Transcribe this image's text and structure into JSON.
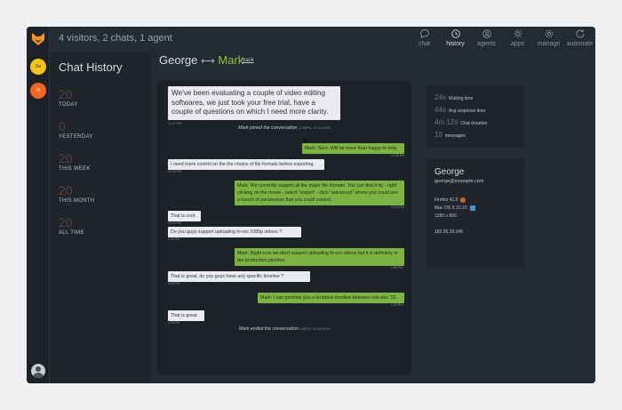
{
  "header": {
    "visitors_text": "4 visitors, 2 chats, 1 agent"
  },
  "nav": [
    {
      "label": "chat",
      "icon": "chat-icon"
    },
    {
      "label": "history",
      "icon": "history-icon",
      "active": true
    },
    {
      "label": "agents",
      "icon": "agents-icon"
    },
    {
      "label": "apps",
      "icon": "apps-icon"
    },
    {
      "label": "manage",
      "icon": "gear-icon"
    },
    {
      "label": "automate",
      "icon": "automate-icon"
    }
  ],
  "rail": {
    "avatars": [
      {
        "initials": "Ge",
        "color": "#f5c518"
      },
      {
        "initials": "N",
        "color": "#f26522"
      }
    ]
  },
  "sidebar": {
    "title": "Chat History",
    "stats": [
      {
        "value": "20",
        "label": "TODAY"
      },
      {
        "value": "0",
        "label": "YESTERDAY"
      },
      {
        "value": "20",
        "label": "THIS WEEK"
      },
      {
        "value": "20",
        "label": "THIS MONTH"
      },
      {
        "value": "20",
        "label": "ALL TIME"
      }
    ]
  },
  "conversation": {
    "visitor": "George",
    "arrow": "⟷",
    "agent": "Mark",
    "back_label": "back",
    "highlight_text": "We've been evaluating a couple of video editing softwares, we just took your free trial, have a couple of questions on which I need more clarity.",
    "highlight_time": "12:07 PM",
    "joined_text": "Mark joined the conversation",
    "joined_time": "12:08PM, 13 Oct 2015",
    "messages": [
      {
        "side": "right",
        "text": "Mark: Sure, Will be more than happy to help.",
        "time": "12:08 PM"
      },
      {
        "side": "left",
        "text": "I need more control on the the choice of file formats before exporting.",
        "time": "12:09 PM"
      },
      {
        "side": "right",
        "text": "Mark: We currently support all the major file formats. You can find it by - right clicking on the movie - select \"export\" - click \"advanced\" where you could see a bunch of parameters that you could control.",
        "time": "12:09 PM"
      },
      {
        "side": "left",
        "text": "That is cool.",
        "time": "12:09 PM"
      },
      {
        "side": "left",
        "text": "Do you guys support uploading hi-res 1080p videos ?",
        "time": "1:40 PM"
      },
      {
        "side": "right",
        "text": "Mark: Right now we don't support uploading hi-res videos but it is definitely in the production pipeline.",
        "time": "1:48 PM"
      },
      {
        "side": "left",
        "text": "That is great, do you guys have any specific timeline ?",
        "time": "1:50 PM"
      },
      {
        "side": "right",
        "text": "Mark: I can promise you a tentative timeline between nov-dec '15.",
        "time": "1:53 PM"
      },
      {
        "side": "left",
        "text": "That is great.",
        "time": "1:55 PM"
      }
    ],
    "ended_text": "Mark ended the conversation",
    "ended_time": "2:00PM, 13 Oct 2015"
  },
  "chat_stats": [
    {
      "value": "24s",
      "label": "Waiting time"
    },
    {
      "value": "44s",
      "label": "Avg response time"
    },
    {
      "value": "4m 12s",
      "label": "Chat duration"
    },
    {
      "value": "10",
      "label": "messages"
    }
  ],
  "visitor_info": {
    "name": "George",
    "email": "george@example.com",
    "browser": "Firefox 41.0",
    "os": "Mac OS X 10.10",
    "resolution": "1280 x 800",
    "ip": "182.65.29.246"
  },
  "colors": {
    "accent_green": "#7cb342",
    "bg_dark": "#242b32",
    "logo_orange": "#f7941d"
  }
}
